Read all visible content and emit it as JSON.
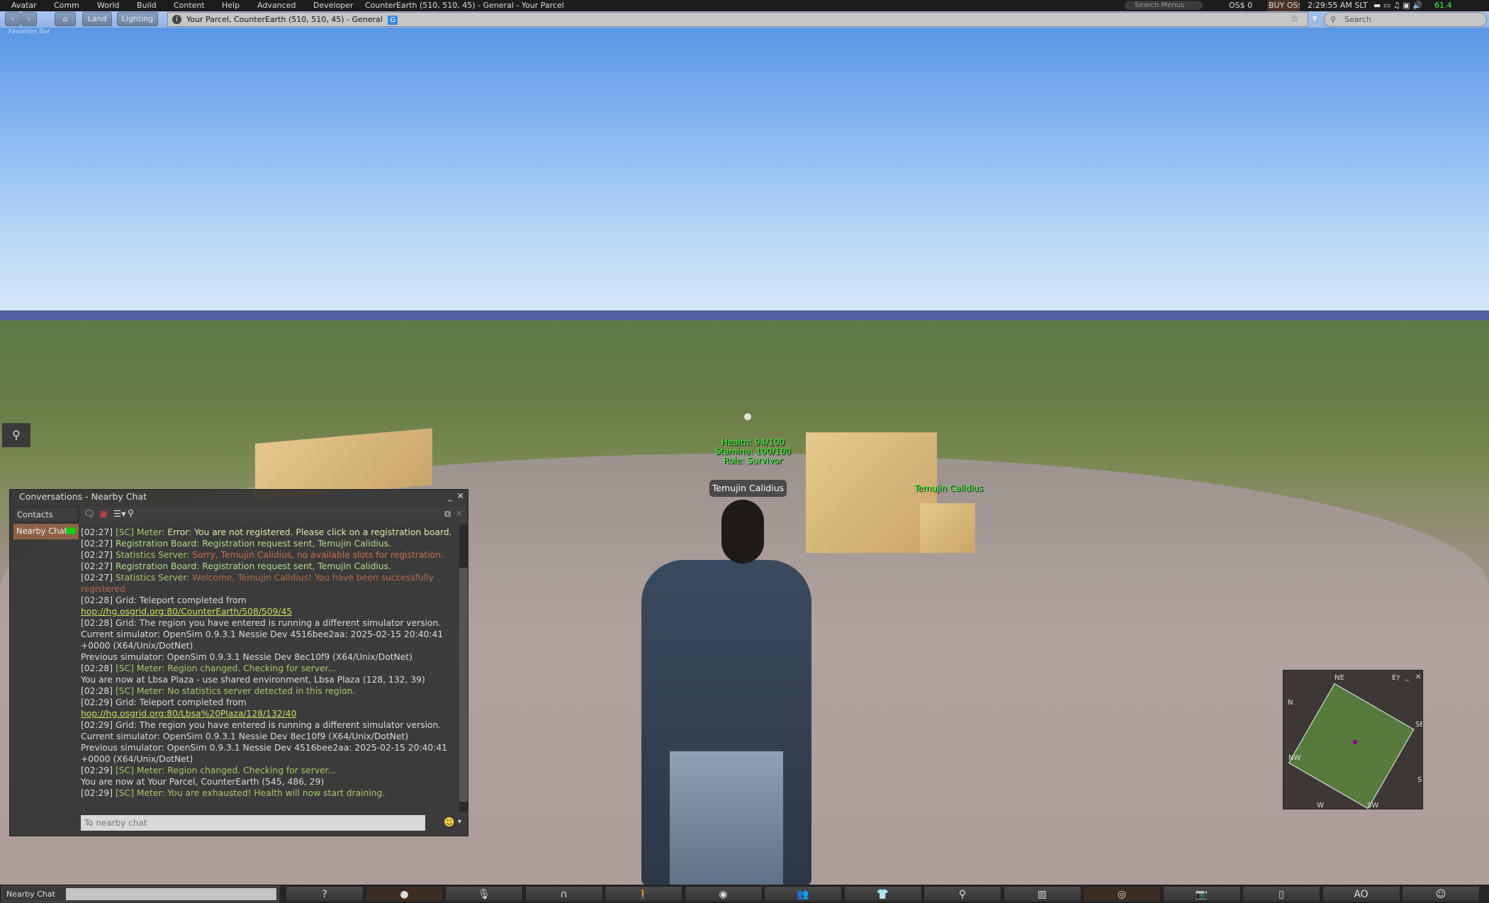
{
  "menubar": {
    "items": [
      "Avatar",
      "Comm",
      "World",
      "Build",
      "Content",
      "Help",
      "Advanced",
      "Developer"
    ],
    "title": "CounterEarth (510, 510, 45) - General - Your Parcel",
    "search_menus": "Search Menus",
    "balance": "OS$ 0",
    "buy": "BUY OS$",
    "time": "2:29:55 AM SLT",
    "fps": "61.4"
  },
  "navbar": {
    "land": "Land",
    "lighting": "Lighting",
    "location": "Your Parcel, CounterEarth (510, 510, 45) - General",
    "rating_badge": "G",
    "search_placeholder": "Search",
    "favorites": "Favorites Bar"
  },
  "scene": {
    "hover_text": [
      "Health: 94/100",
      "Stamina: 100/100",
      "Role: Survivor"
    ],
    "avatar_name": "Temujin Calidius",
    "other_name": "Temujin Calidius"
  },
  "chat": {
    "title": "Conversations - Nearby Chat",
    "contacts": "Contacts",
    "tab": "Nearby Chat",
    "input_placeholder": "To nearby chat",
    "messages": [
      [
        [
          "[02:27] ",
          "def"
        ],
        [
          "[SC] Meter: ",
          "sc"
        ],
        [
          "Error: You are not registered. Please click on a registration board.",
          "msg"
        ]
      ],
      [
        [
          "[02:27] ",
          "def"
        ],
        [
          "Registration Board: Registration request sent, Temujin Calidius.",
          "reg"
        ]
      ],
      [
        [
          "[02:27] ",
          "def"
        ],
        [
          "Statistics Server: ",
          "sc"
        ],
        [
          "Sorry, Temujin Calidius, no available slots for registration.",
          "err"
        ]
      ],
      [
        [
          "[02:27] ",
          "def"
        ],
        [
          "Registration Board: Registration request sent, Temujin Calidius.",
          "reg"
        ]
      ],
      [
        [
          "[02:27] ",
          "def"
        ],
        [
          "Statistics Server: ",
          "sc"
        ],
        [
          "Welcome, Temujin Calidius! You have been successfully registered.",
          "ok"
        ]
      ],
      [
        [
          "[02:28] Grid: Teleport completed from\n",
          "def"
        ],
        [
          "hop://hg.osgrid.org:80/CounterEarth/508/509/45",
          "link"
        ]
      ],
      [
        [
          "[02:28] Grid: The region you have entered is running a different simulator version.\nCurrent simulator: OpenSim 0.9.3.1 Nessie Dev 4516bee2aa: 2025-02-15 20:40:41 +0000 (X64/Unix/DotNet)\nPrevious simulator: OpenSim 0.9.3.1 Nessie Dev 8ec10f9 (X64/Unix/DotNet)",
          "def"
        ]
      ],
      [
        [
          "[02:28] ",
          "def"
        ],
        [
          "[SC] Meter: Region changed. Checking for server...",
          "sc"
        ]
      ],
      [
        [
          "You are now at Lbsa Plaza - use shared environment, Lbsa Plaza (128, 132, 39)",
          "def"
        ]
      ],
      [
        [
          "[02:28] ",
          "def"
        ],
        [
          "[SC] Meter: No statistics server detected in this region.",
          "sc"
        ]
      ],
      [
        [
          "[02:29] Grid: Teleport completed from\n",
          "def"
        ],
        [
          "hop://hg.osgrid.org:80/Lbsa%20Plaza/128/132/40",
          "link"
        ]
      ],
      [
        [
          "[02:29] Grid: The region you have entered is running a different simulator version.\nCurrent simulator: OpenSim 0.9.3.1 Nessie Dev 8ec10f9 (X64/Unix/DotNet)\nPrevious simulator: OpenSim 0.9.3.1 Nessie Dev 4516bee2aa: 2025-02-15 20:40:41 +0000 (X64/Unix/DotNet)",
          "def"
        ]
      ],
      [
        [
          "[02:29] ",
          "def"
        ],
        [
          "[SC] Meter: Region changed. Checking for server...",
          "sc"
        ]
      ],
      [
        [
          "You are now at Your Parcel, CounterEarth (545, 486, 29)",
          "def"
        ]
      ],
      [
        [
          "[02:29] ",
          "def"
        ],
        [
          "[SC] Meter: You are exhausted! Health will now start draining.",
          "sc"
        ]
      ]
    ]
  },
  "minimap": {
    "labels": [
      "N",
      "NE",
      "E",
      "SE",
      "S",
      "SW",
      "W",
      "NW"
    ]
  },
  "toolbar": {
    "nearby_chat": "Nearby Chat",
    "buttons": [
      {
        "icon": "help-icon",
        "glyph": "?"
      },
      {
        "icon": "chat-icon",
        "glyph": "●",
        "active": true
      },
      {
        "icon": "voice-icon",
        "glyph": "🎙"
      },
      {
        "icon": "headphones-icon",
        "glyph": "∩"
      },
      {
        "icon": "walk-icon",
        "glyph": "🚶"
      },
      {
        "icon": "view-icon",
        "glyph": "◉"
      },
      {
        "icon": "people-icon",
        "glyph": "👥"
      },
      {
        "icon": "appearance-icon",
        "glyph": "👕"
      },
      {
        "icon": "search-icon",
        "glyph": "⚲"
      },
      {
        "icon": "map-icon",
        "glyph": "▥"
      },
      {
        "icon": "minimap-icon",
        "glyph": "◎",
        "active": true
      },
      {
        "icon": "snapshot-icon",
        "glyph": "📷"
      },
      {
        "icon": "inventory-icon",
        "glyph": "▯"
      },
      {
        "icon": "ao-icon",
        "glyph": "AO"
      },
      {
        "icon": "gestures-icon",
        "glyph": "☺"
      }
    ]
  }
}
